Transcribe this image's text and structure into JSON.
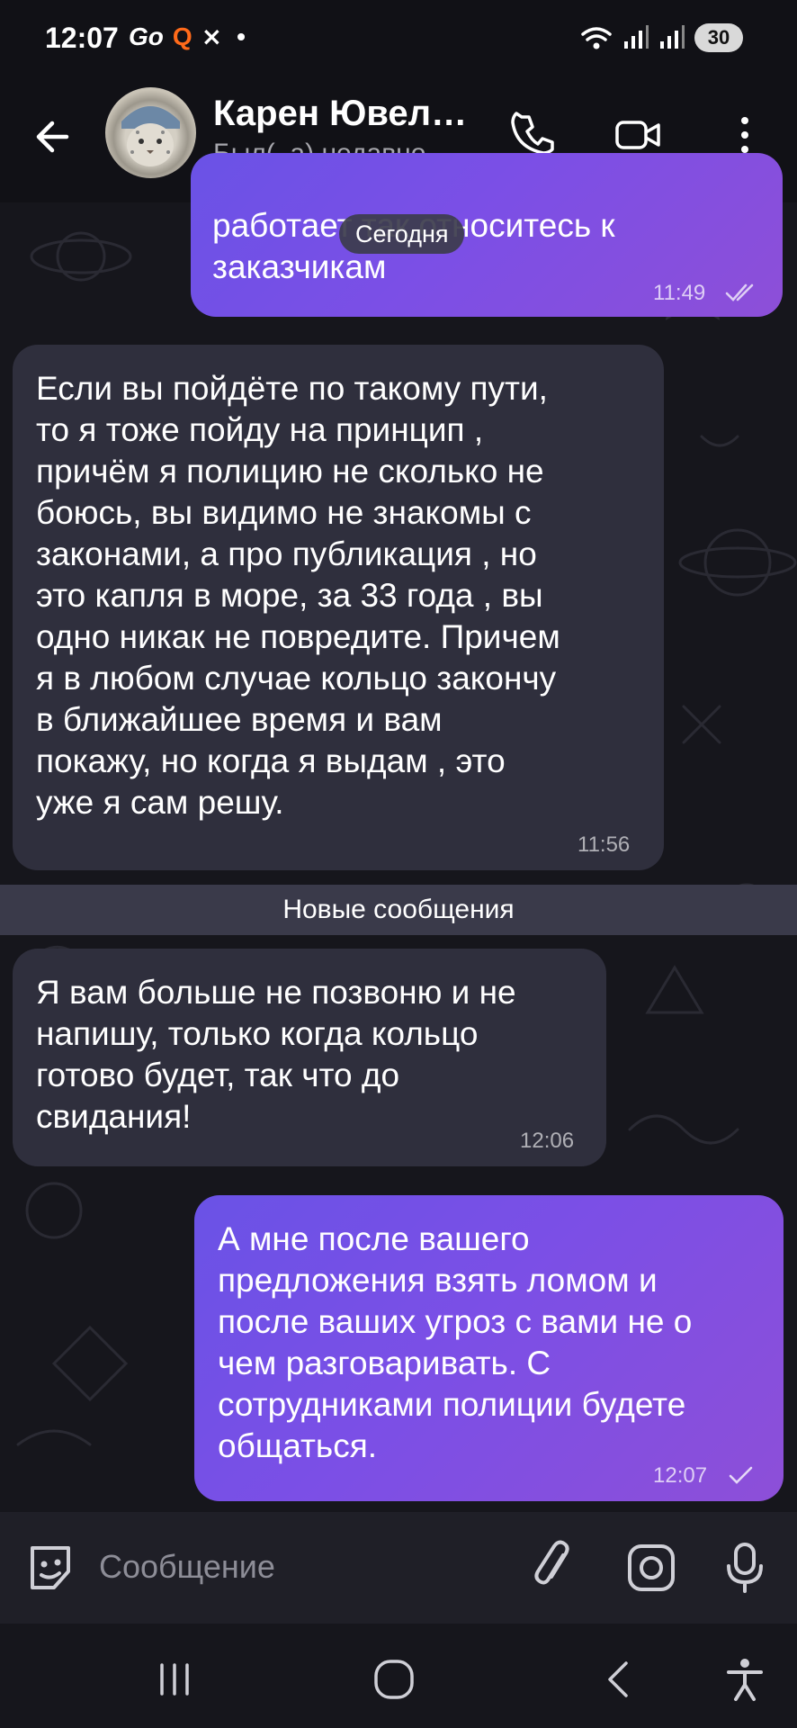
{
  "status_bar": {
    "time": "12:07",
    "left_icons_text": "Go",
    "q_icon": "Q",
    "missed_icon": "⨯",
    "dot": "•",
    "signal_text": "ıl ıl",
    "battery": "30"
  },
  "header": {
    "contact_name": "Карен Ювел…",
    "contact_status": "Был(–а) недавно"
  },
  "chat": {
    "date_pill": "Сегодня",
    "new_messages_label": "Новые сообщения",
    "messages": [
      {
        "direction": "out",
        "text": "работает так относитесь к\nзаказчикам",
        "time": "11:49",
        "status": "read"
      },
      {
        "direction": "in",
        "text": "Если вы пойдёте по такому пути,\nто я тоже пойду на принцип ,\nпричём я полицию не сколько не\nбоюсь, вы видимо не знакомы с\nзаконами, а про публикация , но\nэто капля в море, за 33 года , вы\nодно никак не повредите. Причем\nя в любом случае кольцо закончу\nв ближайшее время и вам\nпокажу, но когда я выдам , это\nуже я сам решу.",
        "time": "11:56"
      },
      {
        "direction": "in",
        "text": "Я вам больше не позвоню и не\nнапишу, только когда кольцо\nготово будет, так что до\nсвидания!",
        "time": "12:06"
      },
      {
        "direction": "out",
        "text": "А мне после вашего\nпредложения взять ломом и\nпосле ваших угроз с вами не о\nчем разговаривать. С\nсотрудниками полиции будете\nобщаться.",
        "time": "12:07",
        "status": "sent"
      }
    ]
  },
  "composer": {
    "placeholder": "Сообщение"
  },
  "icons": {
    "back": "arrow-left-icon",
    "call": "phone-icon",
    "video": "video-call-icon",
    "menu": "more-vertical-icon",
    "emoji": "sticker-emoji-icon",
    "attach": "paperclip-icon",
    "camera": "camera-icon",
    "mic": "microphone-icon"
  },
  "colors": {
    "background": "#16161c",
    "incoming_bubble": "#2f2f3d",
    "outgoing_bubble_start": "#6a52e6",
    "outgoing_bubble_end": "#8d4fd8"
  }
}
